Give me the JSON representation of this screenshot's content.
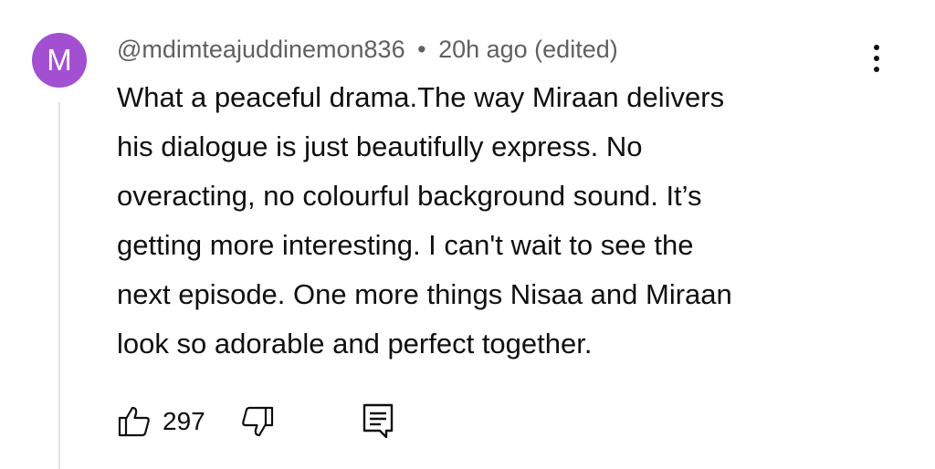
{
  "comment": {
    "avatar_initial": "M",
    "avatar_color": "#a24fd1",
    "author": "@mdimteajuddinemon836",
    "separator": "•",
    "timestamp": "20h ago (edited)",
    "text": "What a peaceful drama.The way Miraan delivers\nhis dialogue is just beautifully  express. No\noveracting, no colourful background sound. It’s\ngetting more interesting. I can't wait to see the\nnext episode. One more things  Nisaa and Miraan\nlook so adorable and perfect together.",
    "likes": "297"
  },
  "icons": {
    "menu": "more-vertical-icon",
    "like": "thumbs-up-icon",
    "dislike": "thumbs-down-icon",
    "reply": "comment-reply-icon"
  }
}
